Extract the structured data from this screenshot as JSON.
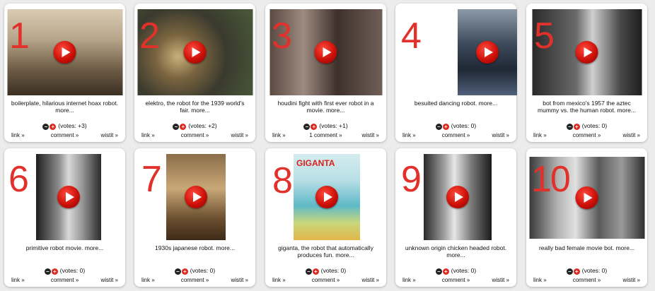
{
  "cards": [
    {
      "rank": "1",
      "caption": "boilerplate, hilarious internet hoax robot. more...",
      "votes": "(votes: +3)",
      "link": "link »",
      "comment": "comment »",
      "wistit": "wistit »",
      "icon": "play-icon"
    },
    {
      "rank": "2",
      "caption": "elektro, the robot for the 1939 world's fair. more...",
      "votes": "(votes: +2)",
      "link": "link »",
      "comment": "comment »",
      "wistit": "wistit »",
      "icon": "play-icon"
    },
    {
      "rank": "3",
      "caption": "houdini fight with first ever robot in a movie. more...",
      "votes": "(votes: +1)",
      "link": "link »",
      "comment": "1 comment »",
      "wistit": "wistit »",
      "icon": "play-icon"
    },
    {
      "rank": "4",
      "caption": "besuited dancing robot. more...",
      "votes": "(votes: 0)",
      "link": "link »",
      "comment": "comment »",
      "wistit": "wistit »",
      "icon": "play-icon"
    },
    {
      "rank": "5",
      "caption": "bot from mexico's 1957 the aztec mummy vs. the human robot. more...",
      "votes": "(votes: 0)",
      "link": "link »",
      "comment": "comment »",
      "wistit": "wistit »",
      "icon": "play-icon"
    },
    {
      "rank": "6",
      "caption": "primitive robot movie. more...",
      "votes": "(votes: 0)",
      "link": "link »",
      "comment": "comment »",
      "wistit": "wistit »",
      "icon": "play-icon"
    },
    {
      "rank": "7",
      "caption": "1930s japanese robot. more...",
      "votes": "(votes: 0)",
      "link": "link »",
      "comment": "comment »",
      "wistit": "wistit »",
      "icon": "play-icon"
    },
    {
      "rank": "8",
      "caption": "giganta, the robot that automatically produces fun. more...",
      "votes": "(votes: 0)",
      "link": "link »",
      "comment": "comment »",
      "wistit": "wistit »",
      "icon": "play-icon",
      "poster_title": "GIGANTA"
    },
    {
      "rank": "9",
      "caption": "unknown origin chicken headed robot. more...",
      "votes": "(votes: 0)",
      "link": "link »",
      "comment": "comment »",
      "wistit": "wistit »",
      "icon": "play-icon"
    },
    {
      "rank": "10",
      "caption": "really bad female movie bot. more...",
      "votes": "(votes: 0)",
      "link": "link »",
      "comment": "comment »",
      "wistit": "wistit »",
      "icon": "play-icon"
    }
  ],
  "colors": {
    "rank": "#e2302a",
    "play": "#cc1108",
    "minus": "#222222",
    "plus": "#e0261c",
    "background": "#ececec"
  }
}
